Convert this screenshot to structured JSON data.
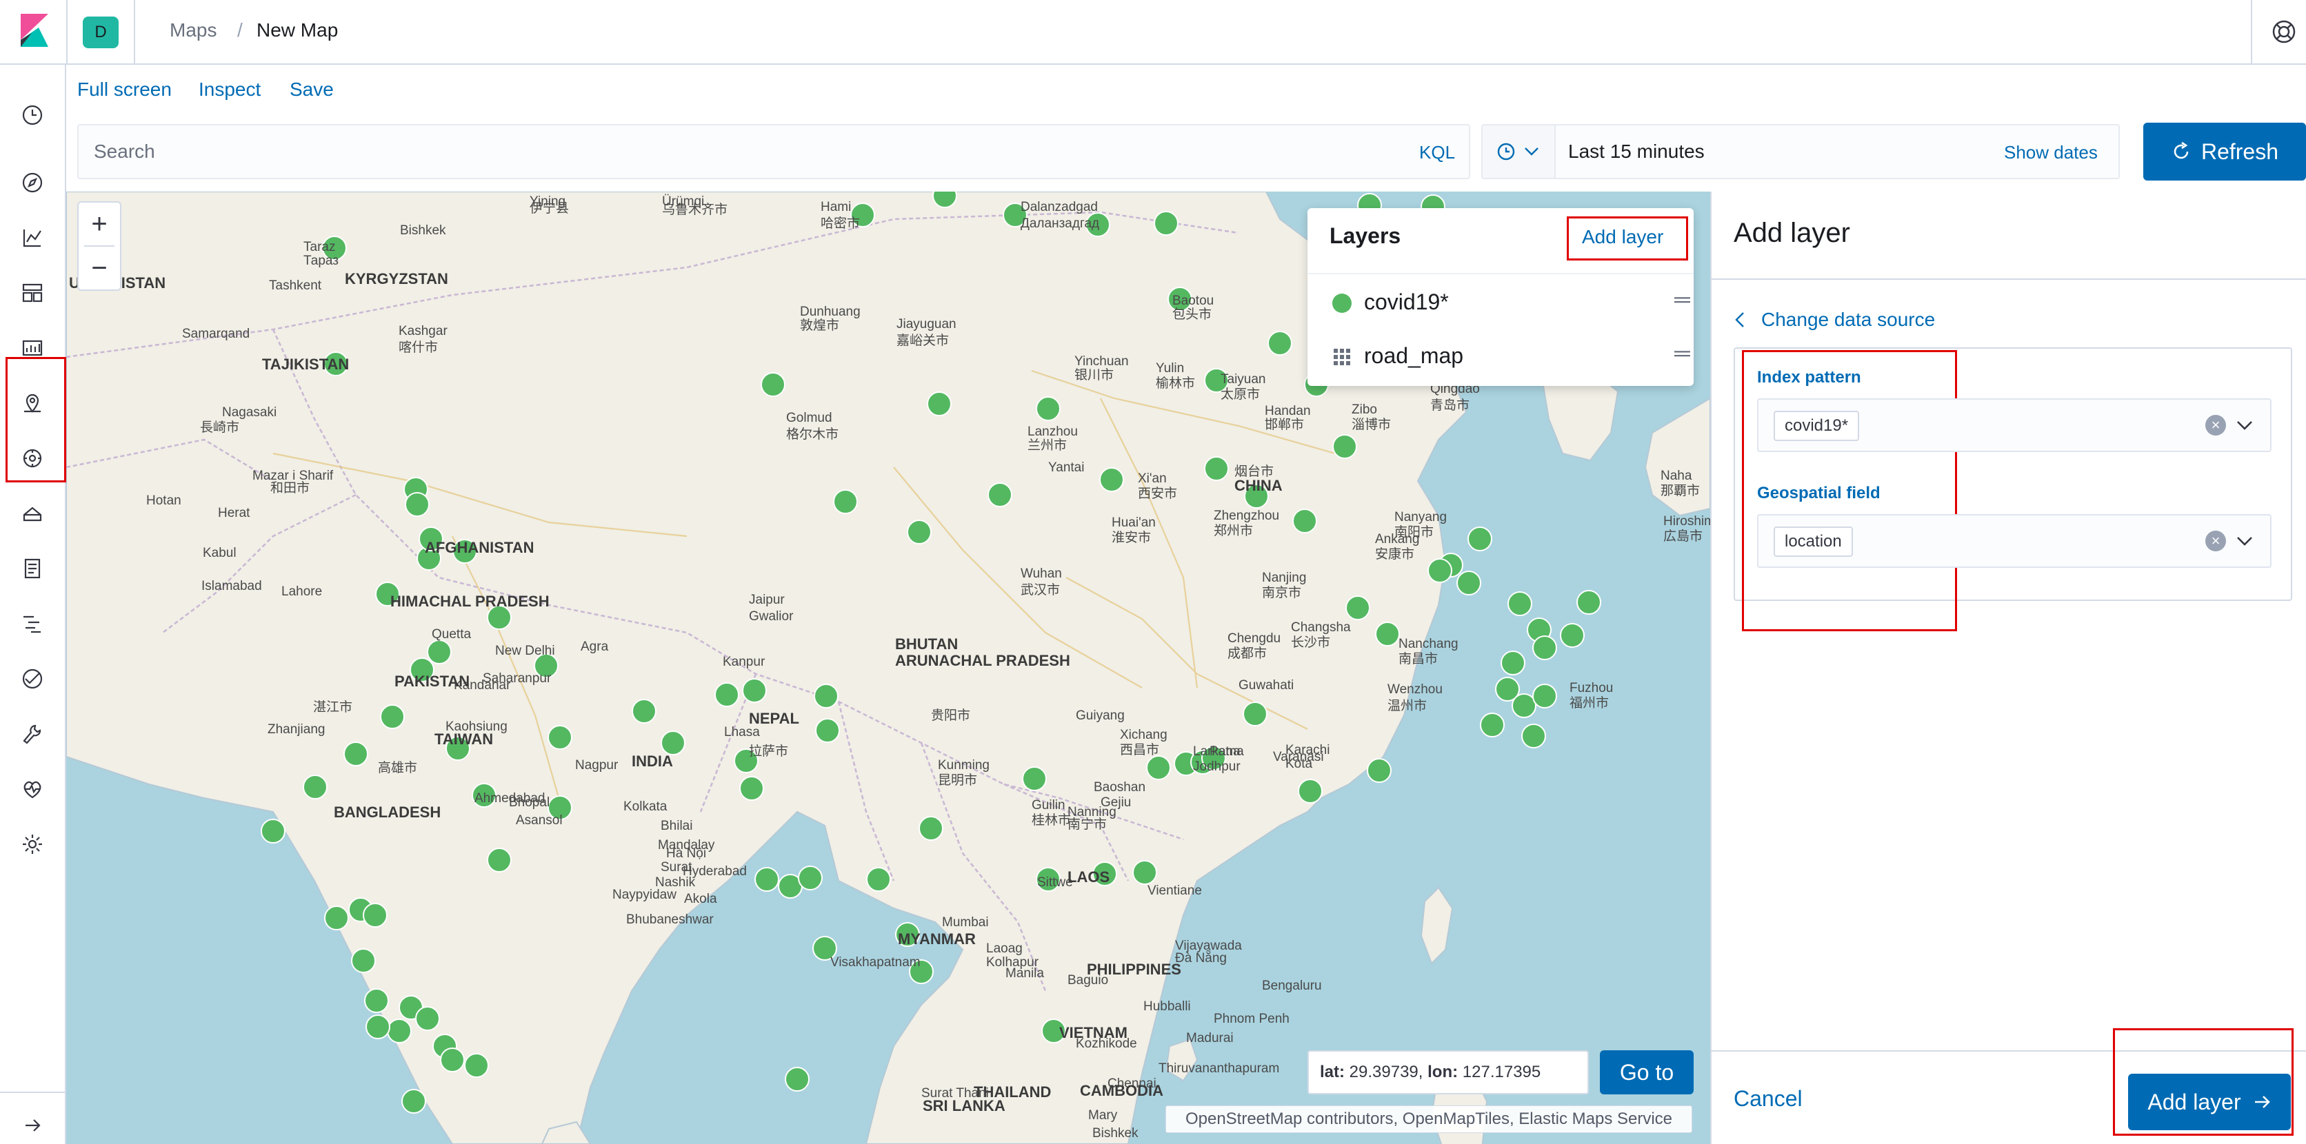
{
  "header": {
    "space_initial": "D",
    "breadcrumb_parent": "Maps",
    "breadcrumb_current": "New Map"
  },
  "top_menu": {
    "full_screen": "Full screen",
    "inspect": "Inspect",
    "save": "Save"
  },
  "query_bar": {
    "search_placeholder": "Search",
    "language": "KQL",
    "time_range": "Last 15 minutes",
    "show_dates": "Show dates",
    "refresh": "Refresh"
  },
  "sidebar": {
    "items": [
      {
        "icon": "clock-icon"
      },
      {
        "icon": "compass-icon"
      },
      {
        "icon": "visualize-icon"
      },
      {
        "icon": "dashboard-icon"
      },
      {
        "icon": "canvas-icon"
      },
      {
        "icon": "maps-icon",
        "active": true
      },
      {
        "icon": "ml-icon"
      },
      {
        "icon": "infrastructure-icon"
      },
      {
        "icon": "logs-icon"
      },
      {
        "icon": "apm-icon"
      },
      {
        "icon": "uptime-icon"
      },
      {
        "icon": "dev-tools-icon"
      },
      {
        "icon": "monitoring-icon"
      },
      {
        "icon": "management-icon"
      }
    ]
  },
  "layers_panel": {
    "title": "Layers",
    "add_layer": "Add layer",
    "layers": [
      {
        "name": "covid19*",
        "type": "point"
      },
      {
        "name": "road_map",
        "type": "tile"
      }
    ]
  },
  "map_labels": [
    "Bishkek",
    "Taraz",
    "Тараз",
    "UZBEKISTAN",
    "KYRGYZSTAN",
    "Tashkent",
    "Samarqand",
    "TAJIKISTAN",
    "Kashgar",
    "喀什市",
    "Yining",
    "伊宁县",
    "Ürümqi",
    "乌鲁木齐市",
    "Hami",
    "哈密市",
    "Dalanzadgad",
    "Даланзадгад",
    "Baotou",
    "包头市",
    "Dunhuang",
    "敦煌市",
    "Jiayuguan",
    "嘉峪关市",
    "Yinchuan",
    "银川市",
    "Yulin",
    "榆林市",
    "Taiyuan",
    "太原市",
    "Golmud",
    "格尔木市",
    "Lanzhou",
    "兰州市",
    "Xi'an",
    "西安市",
    "Handan",
    "邯郸市",
    "Zibo",
    "淄博市",
    "Qingdao",
    "青岛市",
    "Yantai",
    "烟台市",
    "CHINA",
    "Zhengzhou",
    "郑州市",
    "Nanyang",
    "南阳市",
    "Huai'an",
    "淮安市",
    "Ankang",
    "安康市",
    "Nanjing",
    "南京市",
    "Wuhan",
    "武汉市",
    "Chengdu",
    "成都市",
    "Changsha",
    "长沙市",
    "Nanchang",
    "南昌市",
    "Wenzhou",
    "温州市",
    "Fuzhou",
    "福州市",
    "Naha",
    "那覇市",
    "Hiroshim",
    "広島市",
    "Nagasaki",
    "長崎市",
    "Hotan",
    "和田市",
    "Mazar i Sharif",
    "Herat",
    "AFGHANISTAN",
    "Islamabad",
    "Kabul",
    "Lahore",
    "HIMACHAL PRADESH",
    "Quetta",
    "Kandahar",
    "PAKISTAN",
    "Saharanpur",
    "New Delhi",
    "Agra",
    "Jaipur",
    "Gwalior",
    "Kanpur",
    "NEPAL",
    "Lhasa",
    "拉萨市",
    "BHUTAN",
    "ARUNACHAL PRADESH",
    "Xichang",
    "西昌市",
    "Guiyang",
    "贵阳市",
    "Kunming",
    "昆明市",
    "Guilin",
    "桂林市",
    "Larkana",
    "Jodhpur",
    "Karachi",
    "Kota",
    "Varanasi",
    "Patna",
    "Guwahati",
    "Baoshan",
    "Gejiu",
    "Nanning",
    "南宁市",
    "Zhanjiang",
    "湛江市",
    "TAIWAN",
    "Kaohsiung",
    "高雄市",
    "Ahmedabad",
    "Bhopal",
    "Asansol",
    "BANGLADESH",
    "Kolkata",
    "INDIA",
    "Nagpur",
    "Bhilai",
    "Mandalay",
    "Hà Nội",
    "Surat",
    "Nashik",
    "Akola",
    "Bhubaneshwar",
    "Sittwe",
    "Naypyidaw",
    "LAOS",
    "Mumbai",
    "Vientiane",
    "Hyderabad",
    "Visakhapatnam",
    "MYANMAR",
    "Laoag",
    "Kolhapur",
    "Vijayawada",
    "Đà Nẵng",
    "Baguio",
    "Hubballi",
    "THAILAND",
    "Manila",
    "PHILIPPINES",
    "Bengaluru",
    "Chennai",
    "CAMBODIA",
    "VIETNAM",
    "Kozhikode",
    "Madurai",
    "Phnom Penh",
    "Thiruvananthapuram",
    "Surat Thani",
    "SRI LANKA",
    "Mary",
    "Bishkek"
  ],
  "coord_display": {
    "lat_label": "lat:",
    "lat_value": "29.39739",
    "lon_label": "lon:",
    "lon_value": "127.17395"
  },
  "goto_button": "Go to",
  "attribution": "OpenStreetMap contributors, OpenMapTiles, Elastic Maps Service",
  "add_layer_panel": {
    "title": "Add layer",
    "change_data_source": "Change data source",
    "index_pattern_label": "Index pattern",
    "index_pattern_value": "covid19*",
    "geospatial_field_label": "Geospatial field",
    "geospatial_field_value": "location",
    "cancel": "Cancel",
    "add_layer_button": "Add layer"
  },
  "colors": {
    "accent": "#006bb4",
    "point_fill": "#54b861",
    "highlight_box": "#e00000",
    "water": "#aad3df",
    "land": "#f1efe6"
  }
}
